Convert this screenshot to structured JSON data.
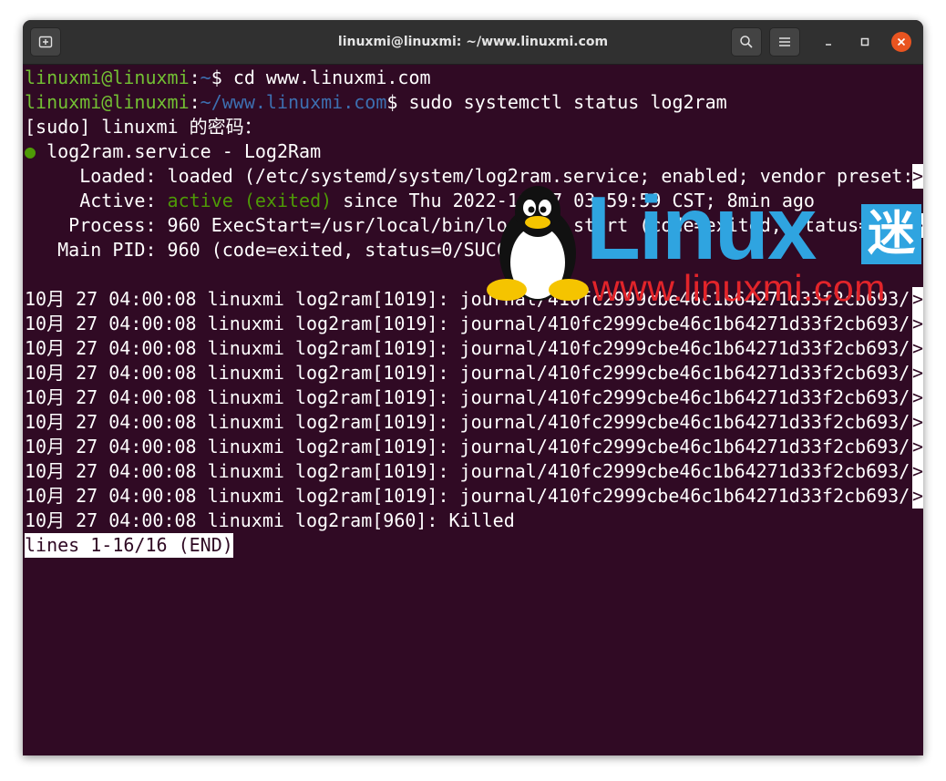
{
  "window": {
    "title": "linuxmi@linuxmi: ~/www.linuxmi.com",
    "accent_close": "#e95420",
    "terminal_bg": "#300a24"
  },
  "icons": {
    "new_tab": "new-tab-icon",
    "search": "search-icon",
    "menu": "hamburger-menu-icon",
    "minimize": "minimize-icon",
    "maximize": "maximize-icon",
    "close": "close-icon"
  },
  "terminal": {
    "line1": {
      "user": "linuxmi@linuxmi",
      "path": "~",
      "prompt": "$ ",
      "cmd": "cd www.linuxmi.com"
    },
    "line2": {
      "user": "linuxmi@linuxmi",
      "path": "~/www.linuxmi.com",
      "prompt": "$ ",
      "cmd": "sudo systemctl status log2ram"
    },
    "sudo_prompt": "[sudo] linuxmi 的密码：",
    "service_dot": "●",
    "service_line": " log2ram.service - Log2Ram",
    "loaded": "     Loaded: loaded (/etc/systemd/system/log2ram.service; enabled; vendor preset:",
    "active_label": "     Active: ",
    "active_status": "active (exited)",
    "active_rest": " since Thu 2022-10-27 03:59:59 CST; 8min ago",
    "process": "    Process: 960 ExecStart=/usr/local/bin/log2ram start (code=exited, status=0/SU",
    "main_pid": "   Main PID: 960 (code=exited, status=0/SUCCESS)",
    "log_lines": [
      "10月 27 04:00:08 linuxmi log2ram[1019]: journal/410fc2999cbe46c1b64271d33f2cb693/",
      "10月 27 04:00:08 linuxmi log2ram[1019]: journal/410fc2999cbe46c1b64271d33f2cb693/",
      "10月 27 04:00:08 linuxmi log2ram[1019]: journal/410fc2999cbe46c1b64271d33f2cb693/",
      "10月 27 04:00:08 linuxmi log2ram[1019]: journal/410fc2999cbe46c1b64271d33f2cb693/",
      "10月 27 04:00:08 linuxmi log2ram[1019]: journal/410fc2999cbe46c1b64271d33f2cb693/",
      "10月 27 04:00:08 linuxmi log2ram[1019]: journal/410fc2999cbe46c1b64271d33f2cb693/",
      "10月 27 04:00:08 linuxmi log2ram[1019]: journal/410fc2999cbe46c1b64271d33f2cb693/",
      "10月 27 04:00:08 linuxmi log2ram[1019]: journal/410fc2999cbe46c1b64271d33f2cb693/",
      "10月 27 04:00:08 linuxmi log2ram[1019]: journal/410fc2999cbe46c1b64271d33f2cb693/"
    ],
    "last_log": "10月 27 04:00:08 linuxmi log2ram[960]: Killed",
    "truncation_marker": ">",
    "pager_status": "lines 1-16/16 (END)"
  },
  "watermark": {
    "brand": "Linux",
    "brand_cn": "迷",
    "site": "www.linuxmi.com"
  }
}
